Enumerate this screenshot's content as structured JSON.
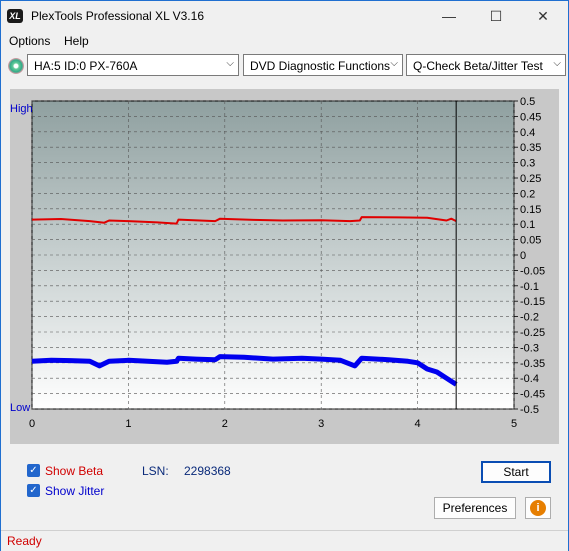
{
  "window": {
    "title": "PlexTools Professional XL V3.16",
    "app_icon_text": "XL",
    "controls": {
      "minimize": "—",
      "maximize": "☐",
      "close": "✕"
    }
  },
  "menu": {
    "options": "Options",
    "help": "Help"
  },
  "toolbar": {
    "drive": "HA:5 ID:0  PX-760A",
    "function": "DVD Diagnostic Functions",
    "test": "Q-Check Beta/Jitter Test"
  },
  "chart_data": {
    "type": "line",
    "left_label_high": "High",
    "left_label_low": "Low",
    "x_ticks": [
      "0",
      "1",
      "2",
      "3",
      "4",
      "5"
    ],
    "xlim": [
      0,
      5
    ],
    "y_ticks": [
      "0.5",
      "0.45",
      "0.4",
      "0.35",
      "0.3",
      "0.25",
      "0.2",
      "0.15",
      "0.1",
      "0.05",
      "0",
      "-0.05",
      "-0.1",
      "-0.15",
      "-0.2",
      "-0.25",
      "-0.3",
      "-0.35",
      "-0.4",
      "-0.45",
      "-0.5"
    ],
    "ylim": [
      -0.5,
      0.5
    ],
    "marker_x": 4.4,
    "grid": true,
    "series": [
      {
        "color": "#e00000",
        "x": [
          0,
          0.3,
          0.6,
          0.75,
          0.8,
          1.0,
          1.3,
          1.5,
          1.52,
          1.9,
          1.95,
          2.3,
          2.6,
          3.0,
          3.3,
          3.4,
          3.42,
          3.8,
          4.1,
          4.3,
          4.35,
          4.4
        ],
        "y": [
          0.115,
          0.117,
          0.11,
          0.105,
          0.112,
          0.11,
          0.106,
          0.102,
          0.115,
          0.11,
          0.118,
          0.114,
          0.112,
          0.113,
          0.11,
          0.112,
          0.123,
          0.122,
          0.121,
          0.112,
          0.118,
          0.11
        ]
      },
      {
        "color": "#0000ee",
        "x": [
          0,
          0.2,
          0.4,
          0.6,
          0.7,
          0.8,
          1.0,
          1.2,
          1.4,
          1.5,
          1.52,
          1.7,
          1.9,
          1.95,
          2.2,
          2.5,
          2.8,
          3.0,
          3.2,
          3.35,
          3.42,
          3.7,
          3.9,
          4.0,
          4.1,
          4.2,
          4.3,
          4.4
        ],
        "y": [
          -0.345,
          -0.342,
          -0.343,
          -0.345,
          -0.36,
          -0.345,
          -0.342,
          -0.345,
          -0.348,
          -0.345,
          -0.335,
          -0.338,
          -0.34,
          -0.33,
          -0.332,
          -0.338,
          -0.335,
          -0.338,
          -0.342,
          -0.36,
          -0.335,
          -0.34,
          -0.345,
          -0.35,
          -0.37,
          -0.38,
          -0.4,
          -0.42
        ]
      }
    ]
  },
  "controls": {
    "show_beta": "Show Beta",
    "show_jitter": "Show Jitter",
    "lsn_label": "LSN:",
    "lsn_value": "2298368",
    "start_button": "Start",
    "preferences_button": "Preferences",
    "info_icon_glyph": "i"
  },
  "status": {
    "text": "Ready"
  },
  "colors": {
    "beta": "#d00000",
    "jitter": "#0000cc",
    "accent": "#0a4db3"
  }
}
